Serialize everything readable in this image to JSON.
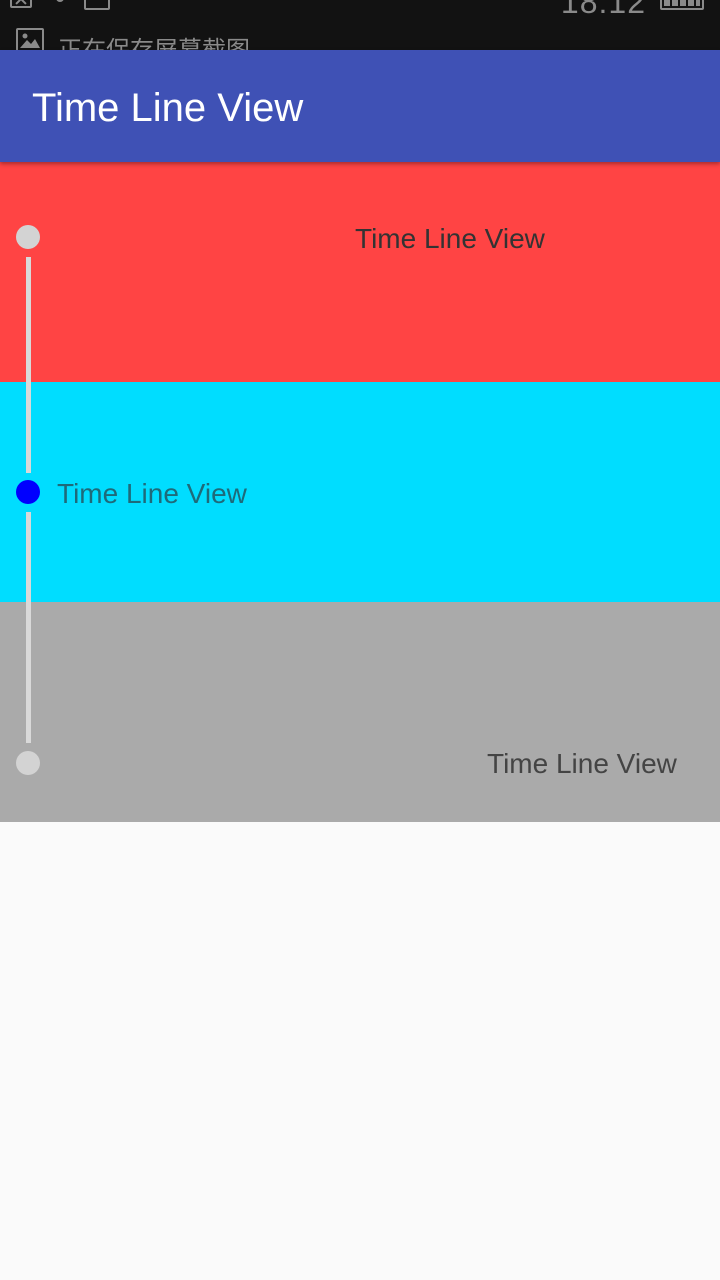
{
  "status_bar": {
    "time": "18:12",
    "notification_text": "正在保存屏幕截图",
    "icons": [
      "close-box-icon",
      "dots-icon",
      "image-icon",
      "battery-icon",
      "image-notification-icon"
    ]
  },
  "app_bar": {
    "title": "Time Line View",
    "color": "#3f51b5"
  },
  "timeline": {
    "items": [
      {
        "label": "Time Line View",
        "background": "#ff4444",
        "dot_color": "#d3d3d3",
        "text_color": "#333333",
        "active": false
      },
      {
        "label": "Time Line View",
        "background": "#00ddff",
        "dot_color": "#0000ff",
        "text_color": "#1e6a7a",
        "active": true
      },
      {
        "label": "Time Line View",
        "background": "#aaaaaa",
        "dot_color": "#d3d3d3",
        "text_color": "#444444",
        "active": false
      }
    ],
    "line_color": "#d9d9d9"
  }
}
